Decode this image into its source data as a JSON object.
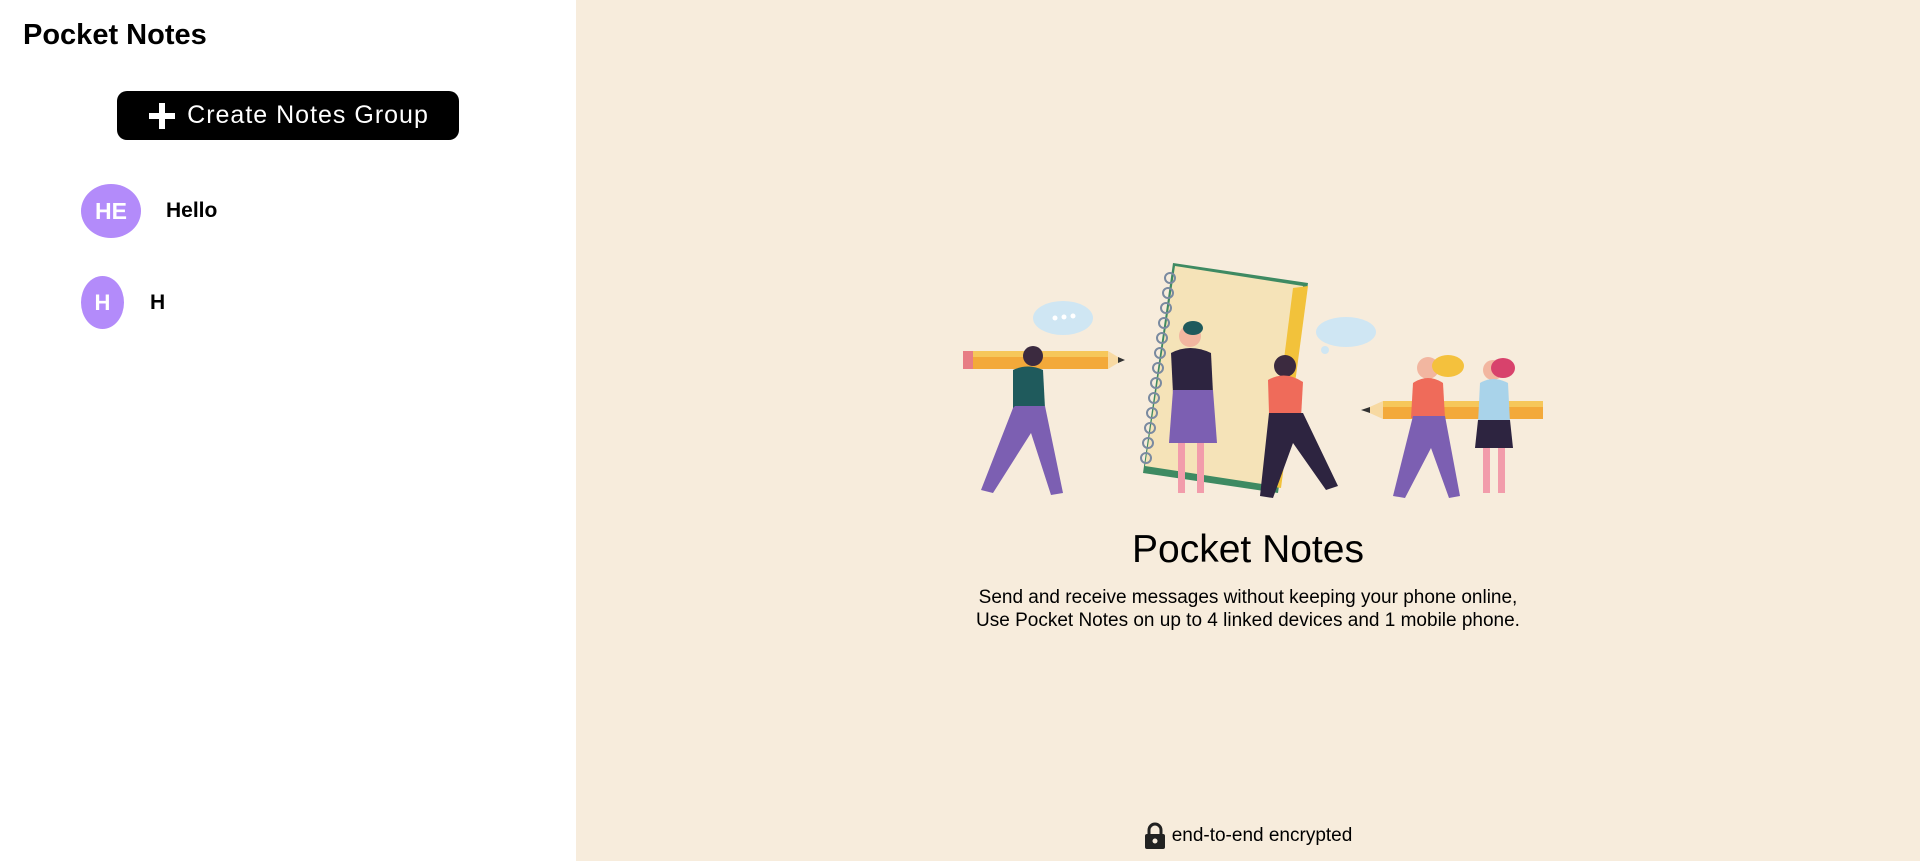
{
  "sidebar": {
    "title": "Pocket Notes",
    "create_button_label": "Create Notes Group",
    "groups": [
      {
        "initials": "HE",
        "name": "Hello",
        "color": "#b38bfa"
      },
      {
        "initials": "H",
        "name": "H",
        "color": "#b38bfa"
      }
    ]
  },
  "main": {
    "title": "Pocket Notes",
    "description_line1": "Send and receive messages without keeping your phone online,",
    "description_line2": "Use Pocket Notes on up to 4 linked devices and 1 mobile phone.",
    "footer_text": "end-to-end encrypted"
  },
  "colors": {
    "sidebar_bg": "#ffffff",
    "main_bg": "#f7ecdc",
    "avatar": "#b38bfa",
    "button": "#000000"
  },
  "icons": {
    "create": "plus-icon",
    "footer": "lock-icon",
    "hero": "people-with-notebook-illustration"
  }
}
